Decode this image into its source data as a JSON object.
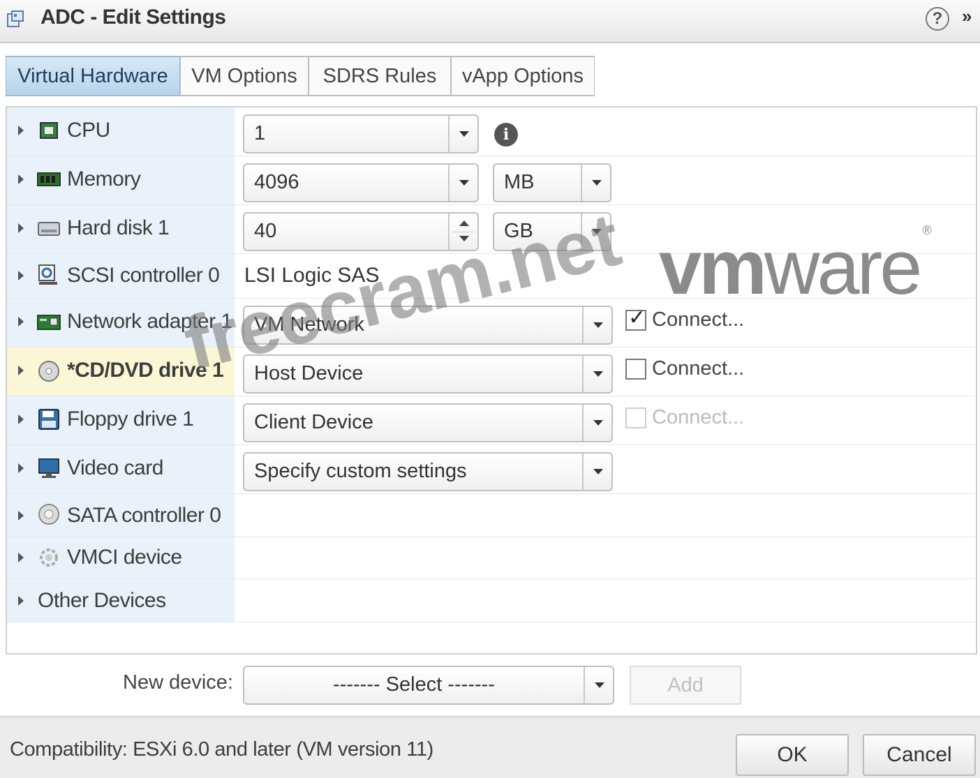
{
  "window": {
    "title": "ADC - Edit Settings",
    "help_label": "?",
    "expand_label": "»"
  },
  "tabs": [
    {
      "label": "Virtual Hardware",
      "active": true
    },
    {
      "label": "VM Options",
      "active": false
    },
    {
      "label": "SDRS Rules",
      "active": false
    },
    {
      "label": "vApp Options",
      "active": false
    }
  ],
  "devices": [
    {
      "name": "CPU",
      "icon": "cpu-icon",
      "value": "1"
    },
    {
      "name": "Memory",
      "icon": "memory-icon",
      "value": "4096",
      "unit": "MB"
    },
    {
      "name": "Hard disk 1",
      "icon": "hard-disk-icon",
      "value": "40",
      "unit": "GB"
    },
    {
      "name": "SCSI controller 0",
      "icon": "scsi-controller-icon",
      "value": "LSI Logic SAS"
    },
    {
      "name": "Network adapter 1",
      "icon": "network-adapter-icon",
      "value": "VM Network",
      "connect_label": "Connect...",
      "connected": true
    },
    {
      "name": "*CD/DVD drive 1",
      "icon": "cd-dvd-icon",
      "value": "Host Device",
      "connect_label": "Connect...",
      "connected": false,
      "highlighted": true
    },
    {
      "name": "Floppy drive 1",
      "icon": "floppy-icon",
      "value": "Client Device",
      "connect_label": "Connect...",
      "connected": false,
      "disabled": true
    },
    {
      "name": "Video card",
      "icon": "video-card-icon",
      "value": "Specify custom settings"
    },
    {
      "name": "SATA controller 0",
      "icon": "sata-controller-icon"
    },
    {
      "name": "VMCI device",
      "icon": "vmci-icon"
    },
    {
      "name": "Other Devices"
    }
  ],
  "new_device": {
    "label": "New device:",
    "select_value": "------- Select -------",
    "add_label": "Add"
  },
  "footer": {
    "compatibility": "Compatibility: ESXi 6.0 and later (VM version 11)",
    "ok_label": "OK",
    "cancel_label": "Cancel"
  },
  "watermarks": {
    "vmware_vm": "vm",
    "vmware_ware": "ware",
    "vmware_reg": "®",
    "freecram": "freecram.net"
  },
  "colors": {
    "active_tab": "#c6dcf1",
    "label_column": "#e9f2fb",
    "highlight_row": "#fbf7d6"
  }
}
